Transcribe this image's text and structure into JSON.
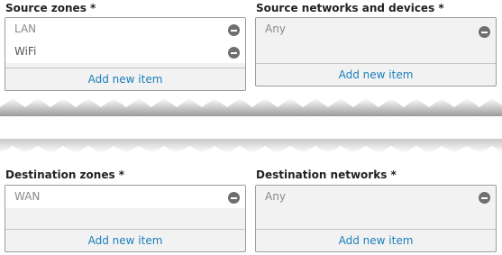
{
  "source_zones": {
    "label": "Source zones *",
    "items": [
      "LAN",
      "WiFi"
    ],
    "add_label": "Add new item"
  },
  "source_networks": {
    "label": "Source networks and devices *",
    "placeholder": "Any",
    "add_label": "Add new item"
  },
  "destination_zones": {
    "label": "Destination zones *",
    "items": [
      "WAN"
    ],
    "add_label": "Add new item"
  },
  "destination_networks": {
    "label": "Destination networks *",
    "placeholder": "Any",
    "add_label": "Add new item"
  },
  "colors": {
    "link": "#1a7fba",
    "remove_icon": "#6f6f6f",
    "border": "#9c9c9c",
    "panel_bg": "#f2f2f2"
  }
}
